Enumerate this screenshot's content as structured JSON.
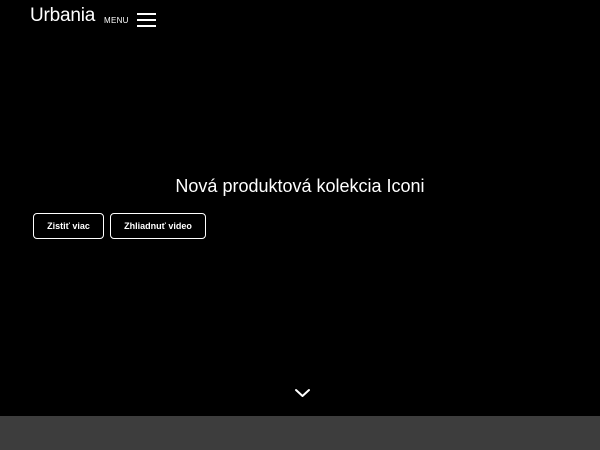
{
  "header": {
    "logo_text": "Urbania",
    "menu_label": "MENU",
    "menu_icon": "hamburger-icon"
  },
  "hero": {
    "headline": "Nová produktová kolekcia Iconi",
    "buttons": [
      {
        "label": "Zistiť viac"
      },
      {
        "label": "Zhliadnuť video"
      }
    ],
    "scroll_icon": "chevron-down-icon"
  },
  "colors": {
    "background": "#000000",
    "text": "#ffffff",
    "bottom_strip": "#3d3d3d"
  }
}
